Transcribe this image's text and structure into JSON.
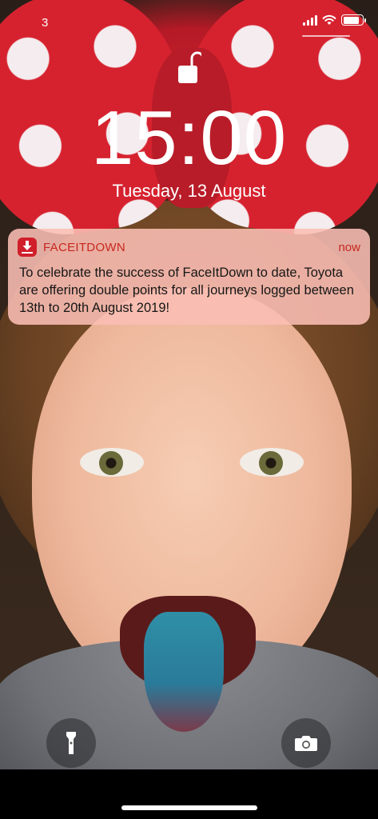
{
  "status_bar": {
    "carrier": "3",
    "battery_level": 0.85
  },
  "lock_screen": {
    "lock_icon": "unlocked-padlock-icon",
    "time": "15:00",
    "date": "Tuesday, 13 August"
  },
  "notification": {
    "app_icon": "faceitdown-app-icon",
    "app_name": "FACEITDOWN",
    "time": "now",
    "body": "To celebrate the success of FaceItDown to date, Toyota are offering double points for all journeys logged between 13th to 20th August 2019!",
    "accent_color": "#c7271f"
  },
  "quick_actions": {
    "flashlight_icon": "flashlight-icon",
    "camera_icon": "camera-icon"
  }
}
